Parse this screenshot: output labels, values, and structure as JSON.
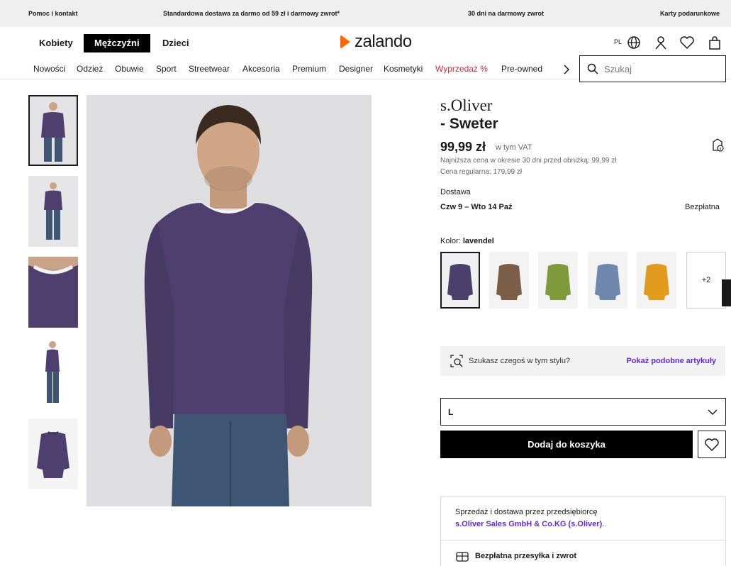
{
  "topbar": {
    "help": "Pomoc i kontakt",
    "delivery": "Standardowa dostawa za darmo od 59 zł i darmowy zwrot*",
    "returns": "30 dni na darmowy zwrot",
    "giftcards": "Karty podarunkowe"
  },
  "header": {
    "genders": [
      "Kobiety",
      "Mężczyźni",
      "Dzieci"
    ],
    "active_gender": "Mężczyźni",
    "logo": "zalando",
    "lang": "PL"
  },
  "nav": {
    "items": [
      "Nowości",
      "Odzież",
      "Obuwie",
      "Sport",
      "Streetwear",
      "Akcesoria",
      "Premium",
      "Designer",
      "Kosmetyki",
      "Wyprzedaż %",
      "Pre-owned"
    ],
    "search_placeholder": "Szukaj"
  },
  "product": {
    "brand": "s.Oliver",
    "name": "- Sweter",
    "price": "99,99 zł",
    "vat": "w tym VAT",
    "lowest_price": "Najniższa cena w okresie 30 dni przed obniżką: 99,99 zł",
    "regular_price": "Cena regularna: 179,99 zł",
    "delivery_label": "Dostawa",
    "delivery_dates": "Czw 9 – Wto 14 Paź",
    "delivery_cost": "Bezpłatna",
    "color_label": "Kolor:",
    "color_value": "lavendel",
    "more_colors": "+2",
    "similar_text": "Szukasz czegoś w tym stylu?",
    "similar_link": "Pokaż podobne artykuły",
    "size": "L",
    "add_to_cart": "Dodaj do koszyka"
  },
  "swatches": [
    "#4b3f6b",
    "#7a5e48",
    "#7f9a3a",
    "#6f86ad",
    "#e39b1e"
  ],
  "seller": {
    "line1": "Sprzedaż i dostawa przez przedsiębiorcę",
    "name": "s.Oliver Sales GmbH & Co.KG (s.Oliver)",
    "name_end": ".",
    "shipping": "Bezpłatna przesyłka i zwrot"
  },
  "colors": {
    "accent": "#ff6900",
    "link": "#6328e0",
    "sale": "#d12a3b",
    "sweater": "#4e3f6e"
  }
}
